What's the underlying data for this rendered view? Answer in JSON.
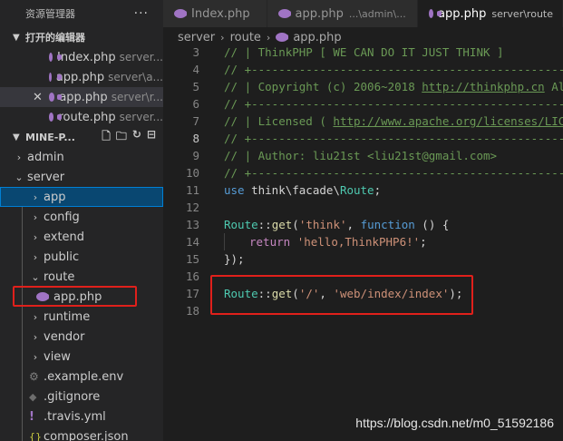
{
  "sidebar": {
    "title": "资源管理器",
    "more": "···",
    "open_editors": {
      "title": "打开的编辑器",
      "items": [
        {
          "name": "Index.php",
          "desc": "server..."
        },
        {
          "name": "app.php",
          "desc": "server\\a..."
        },
        {
          "name": "app.php",
          "desc": "server\\r..."
        },
        {
          "name": "route.php",
          "desc": "server..."
        }
      ]
    },
    "workspace": {
      "title": "MINE-P...",
      "tree": [
        {
          "label": "admin",
          "type": "folder"
        },
        {
          "label": "server",
          "type": "folder-open"
        },
        {
          "label": "app",
          "type": "folder"
        },
        {
          "label": "config",
          "type": "folder"
        },
        {
          "label": "extend",
          "type": "folder"
        },
        {
          "label": "public",
          "type": "folder"
        },
        {
          "label": "route",
          "type": "folder-open"
        },
        {
          "label": "app.php",
          "type": "php"
        },
        {
          "label": "runtime",
          "type": "folder"
        },
        {
          "label": "vendor",
          "type": "folder"
        },
        {
          "label": "view",
          "type": "folder"
        },
        {
          "label": ".example.env",
          "type": "gear"
        },
        {
          "label": ".gitignore",
          "type": "diamond"
        },
        {
          "label": ".travis.yml",
          "type": "excl"
        },
        {
          "label": "composer.json",
          "type": "json"
        }
      ]
    }
  },
  "tabs": [
    {
      "label": "Index.php",
      "desc": ""
    },
    {
      "label": "app.php",
      "desc": "...\\admin\\..."
    },
    {
      "label": "app.php",
      "desc": "server\\route"
    }
  ],
  "breadcrumb": [
    "server",
    "route",
    "app.php"
  ],
  "code": {
    "line_numbers": [
      "3",
      "4",
      "5",
      "6",
      "7",
      "8",
      "9",
      "10",
      "11",
      "12",
      "13",
      "14",
      "15",
      "16",
      "17",
      "18"
    ],
    "lines": {
      "l3": "// | ThinkPHP [ WE CAN DO IT JUST THINK ]",
      "l4": "// +----------------------------------------------------------------------",
      "l5a": "// | Copyright (c) 2006~2018 ",
      "l5b": "http://thinkphp.cn",
      "l5c": " All",
      "l6": "// +----------------------------------------------------------------------",
      "l7a": "// | Licensed ( ",
      "l7b": "http://www.apache.org/licenses/LICENSE",
      "l8": "// +----------------------------------------------------------------------",
      "l9": "// | Author: liu21st <liu21st@gmail.com>",
      "l10": "// +----------------------------------------------------------------------",
      "l11_kw": "use",
      "l11_ns": " think\\facade\\",
      "l11_cls": "Route",
      "l11_end": ";",
      "l13_cls": "Route",
      "l13_op": "::",
      "l13_fn": "get",
      "l13_p1": "(",
      "l13_str": "'think'",
      "l13_p2": ", ",
      "l13_kw": "function",
      "l13_p3": " () {",
      "l14_kw": "return",
      "l14_sp": " ",
      "l14_str": "'hello,ThinkPHP6!'",
      "l14_end": ";",
      "l15": "});",
      "l17_cls": "Route",
      "l17_op": "::",
      "l17_fn": "get",
      "l17_p1": "(",
      "l17_s1": "'/'",
      "l17_p2": ", ",
      "l17_s2": "'web/index/index'",
      "l17_end": ");"
    }
  },
  "watermark": "https://blog.csdn.net/m0_51592186",
  "colors": {
    "highlight_box": "#e0201b",
    "php_icon": "#a074c4",
    "selection": "#094771"
  }
}
